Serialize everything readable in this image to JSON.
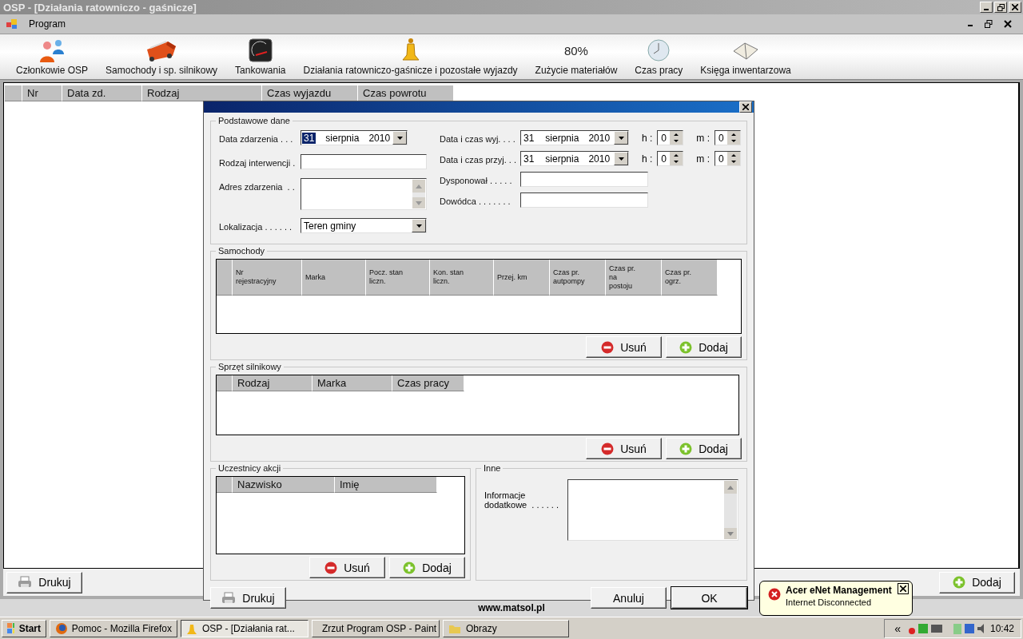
{
  "window": {
    "title": "OSP - [Działania ratowniczo - gaśnicze]"
  },
  "menu": [
    {
      "label": "Program"
    }
  ],
  "toolbar": [
    {
      "label": "Członkowie OSP",
      "kind": "members"
    },
    {
      "label": "Samochody i sp. silnikowy",
      "kind": "truck"
    },
    {
      "label": "Tankowania",
      "kind": "gauge"
    },
    {
      "label": "Działania ratowniczo-gaśnicze i pozostałe wyjazdy",
      "kind": "bell"
    },
    {
      "label": "Zużycie materiałów",
      "kind": "percent",
      "icon_text": "80%"
    },
    {
      "label": "Czas pracy",
      "kind": "clock"
    },
    {
      "label": "Księga inwentarzowa",
      "kind": "book"
    }
  ],
  "list": {
    "columns": [
      "Nr",
      "Data zd.",
      "Rodzaj",
      "Czas wyjazdu",
      "Czas powrotu"
    ]
  },
  "main_buttons": [
    {
      "label": "Drukuj",
      "kind": "print"
    },
    {
      "label": "Dodaj",
      "kind": "add"
    }
  ],
  "dialog": {
    "basic": {
      "title": "Podstawowe dane",
      "left": [
        {
          "label": "Data zdarzenia . . .",
          "kind": "date",
          "day": "31",
          "month": "sierpnia",
          "year": "2010",
          "focused": true
        },
        {
          "label": "Rodzaj interwencji .",
          "kind": "text"
        },
        {
          "label": "Adres zdarzenia  . .",
          "kind": "memo"
        },
        {
          "label": "Lokalizacja . . . . . .",
          "kind": "combo",
          "value": "Teren gminy"
        }
      ],
      "right": [
        {
          "label": "Data i czas wyj. . . .",
          "kind": "datetime",
          "day": "31",
          "month": "sierpnia",
          "year": "2010",
          "focused": false,
          "hour_label": "h :",
          "hour": "0",
          "minute_label": "m :",
          "minute": "0"
        },
        {
          "label": "Data i czas przyj. . .",
          "kind": "datetime",
          "day": "31",
          "month": "sierpnia",
          "year": "2010",
          "focused": false,
          "hour_label": "h :",
          "hour": "0",
          "minute_label": "m :",
          "minute": "0"
        },
        {
          "label": "Dysponował . . . . .",
          "kind": "text"
        },
        {
          "label": "Dowódca . . . . . . .",
          "kind": "text"
        }
      ]
    },
    "cars": {
      "title": "Samochody",
      "columns": [
        "Nr\nrejestracyjny",
        "Marka",
        "Pocz. stan\nliczn.",
        "Kon. stan\nliczn.",
        "Przej. km",
        "Czas pr.\nautpompy",
        "Czas pr.\nna\npostoju",
        "Czas pr.\nogrz."
      ],
      "buttons": [
        {
          "label": "Usuń",
          "kind": "remove"
        },
        {
          "label": "Dodaj",
          "kind": "add"
        }
      ]
    },
    "equipment": {
      "title": "Sprzęt silnikowy",
      "columns": [
        "Rodzaj",
        "Marka",
        "Czas pracy"
      ],
      "buttons": [
        {
          "label": "Usuń",
          "kind": "remove"
        },
        {
          "label": "Dodaj",
          "kind": "add"
        }
      ]
    },
    "participants": {
      "title": "Uczestnicy akcji",
      "columns": [
        "Nazwisko",
        "Imię"
      ],
      "buttons": [
        {
          "label": "Usuń",
          "kind": "remove"
        },
        {
          "label": "Dodaj",
          "kind": "add"
        }
      ]
    },
    "other": {
      "title": "Inne",
      "label": "Informacje\ndodatkowe  . . . . . ."
    },
    "buttons": [
      {
        "label": "Drukuj",
        "kind": "print"
      },
      {
        "label": "Anuluj",
        "kind": "cancel"
      },
      {
        "label": "OK",
        "kind": "ok"
      }
    ]
  },
  "footer": "www.matsol.pl",
  "taskbar": {
    "start": "Start",
    "tasks": [
      {
        "label": "Pomoc - Mozilla Firefox",
        "kind": "firefox",
        "selected": false
      },
      {
        "label": "OSP - [Działania rat...",
        "kind": "bell",
        "selected": true
      },
      {
        "label": "Zrzut Program OSP - Paint",
        "kind": "paint",
        "selected": false
      },
      {
        "label": "Obrazy",
        "kind": "folder",
        "selected": false
      }
    ],
    "tray_toggle": "«",
    "clock": "10:42"
  },
  "balloon": {
    "title": "Acer eNet Management",
    "message": "Internet Disconnected"
  }
}
